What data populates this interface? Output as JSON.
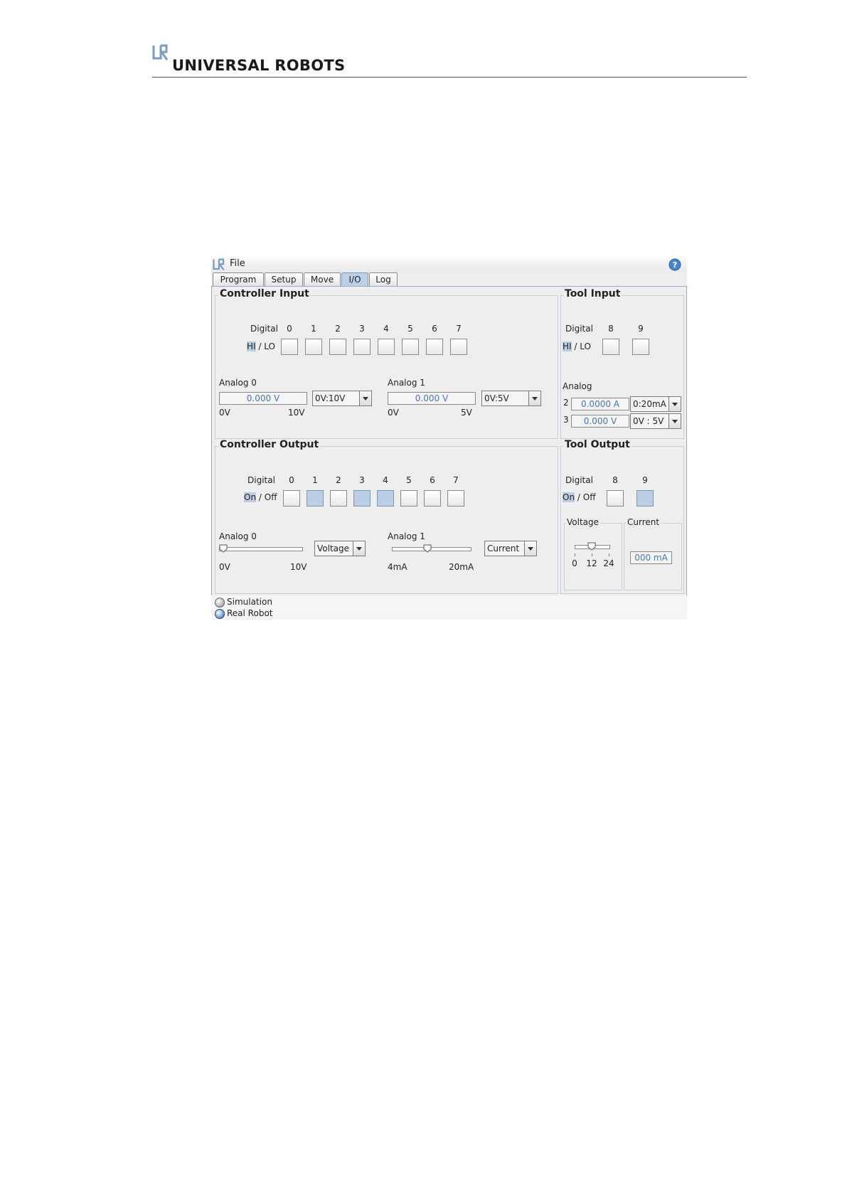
{
  "page_header": {
    "brand": "UNIVERSAL ROBOTS"
  },
  "window": {
    "menu": {
      "file_label": "File"
    },
    "tabs": [
      {
        "label": "Program",
        "active": false
      },
      {
        "label": "Setup",
        "active": false
      },
      {
        "label": "Move",
        "active": false
      },
      {
        "label": "I/O",
        "active": true
      },
      {
        "label": "Log",
        "active": false
      }
    ],
    "controller_input": {
      "title": "Controller Input",
      "digital_label": "Digital",
      "channels": [
        "0",
        "1",
        "2",
        "3",
        "4",
        "5",
        "6",
        "7"
      ],
      "hi_label": "HI",
      "sep": "/",
      "lo_label": "LO",
      "states": [
        false,
        false,
        false,
        false,
        false,
        false,
        false,
        false
      ],
      "analog0": {
        "label": "Analog 0",
        "value": "0.000 V",
        "range": "0V:10V",
        "min": "0V",
        "max": "10V"
      },
      "analog1": {
        "label": "Analog 1",
        "value": "0.000 V",
        "range": "0V:5V",
        "min": "0V",
        "max": "5V"
      }
    },
    "tool_input": {
      "title": "Tool Input",
      "digital_label": "Digital",
      "channels": [
        "8",
        "9"
      ],
      "hi_label": "HI",
      "sep": "/",
      "lo_label": "LO",
      "states": [
        false,
        false
      ],
      "analog_label": "Analog",
      "analog": [
        {
          "channel": "2",
          "value": "0.0000 A",
          "range": "0:20mA"
        },
        {
          "channel": "3",
          "value": "0.000 V",
          "range": "0V : 5V"
        }
      ]
    },
    "controller_output": {
      "title": "Controller Output",
      "digital_label": "Digital",
      "channels": [
        "0",
        "1",
        "2",
        "3",
        "4",
        "5",
        "6",
        "7"
      ],
      "on_label": "On",
      "sep": "/",
      "off_label": "Off",
      "states": [
        false,
        true,
        false,
        true,
        true,
        false,
        false,
        false
      ],
      "analog0": {
        "label": "Analog 0",
        "mode": "Voltage",
        "min": "0V",
        "max": "10V",
        "level": 0.0
      },
      "analog1": {
        "label": "Analog 1",
        "mode": "Current",
        "min": "4mA",
        "max": "20mA",
        "level": 0.45
      }
    },
    "tool_output": {
      "title": "Tool Output",
      "digital_label": "Digital",
      "channels": [
        "8",
        "9"
      ],
      "on_label": "On",
      "sep": "/",
      "off_label": "Off",
      "states": [
        false,
        true
      ],
      "voltage": {
        "label": "Voltage",
        "ticks": [
          "0",
          "12",
          "24"
        ],
        "level": 0.5
      },
      "current": {
        "label": "Current",
        "value": "000 mA"
      }
    },
    "status": {
      "options": [
        {
          "label": "Simulation",
          "color": "#8a8a8a"
        },
        {
          "label": "Real Robot",
          "color": "#2f63b0"
        }
      ]
    }
  }
}
